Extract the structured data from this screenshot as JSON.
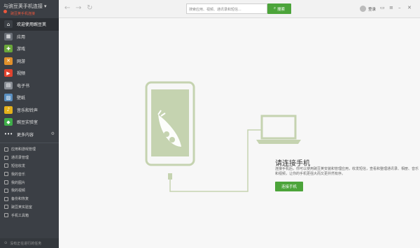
{
  "sidebar": {
    "device_title": "与豌豆荚手机连接",
    "device_subtitle": "豌豆荚手机连接",
    "nav": [
      {
        "label": "欢迎使用豌豆荚",
        "icon": "home-icon",
        "color": "#3b3f45"
      },
      {
        "label": "应用",
        "icon": "apps-icon",
        "color": "#6a6f77"
      },
      {
        "label": "游戏",
        "icon": "gamepad-icon",
        "color": "#6aa63a"
      },
      {
        "label": "网游",
        "icon": "crossed-swords-icon",
        "color": "#e0902b"
      },
      {
        "label": "视频",
        "icon": "play-icon",
        "color": "#e0432e"
      },
      {
        "label": "电子书",
        "icon": "book-icon",
        "color": "#8a8f96"
      },
      {
        "label": "壁纸",
        "icon": "image-icon",
        "color": "#5a8fc0"
      },
      {
        "label": "音乐和铃声",
        "icon": "music-icon",
        "color": "#e4b11b"
      },
      {
        "label": "豌豆实验室",
        "icon": "lab-icon",
        "color": "#3fae49"
      },
      {
        "label": "更多内容",
        "icon": "more-dots-icon",
        "color": "#3b3f45"
      }
    ],
    "tools": [
      {
        "label": "应用和游戏管理"
      },
      {
        "label": "通讯录管理"
      },
      {
        "label": "短信收发"
      },
      {
        "label": "我的音乐"
      },
      {
        "label": "我的图片"
      },
      {
        "label": "我的视频"
      },
      {
        "label": "备份和恢复"
      },
      {
        "label": "豌豆荚实验室"
      },
      {
        "label": "手机工具箱"
      }
    ],
    "footer": "没有正在进行的任务"
  },
  "topbar": {
    "search_placeholder": "搜索应用、视频、通讯录和短信...",
    "search_button": "搜索",
    "login": "登录"
  },
  "main": {
    "title": "请连接手机",
    "description": "连接手机后，你可以使用豌豆荚安装和管理应用，收发短信，查看和整理通讯录、相册、音乐和视频，让你的手机更强大而又更井然有序。",
    "connect_button": "连接手机"
  },
  "colors": {
    "accent": "#4ca43a",
    "illustration": "#c5d3b0",
    "sidebar_bg": "#3b3f45"
  }
}
